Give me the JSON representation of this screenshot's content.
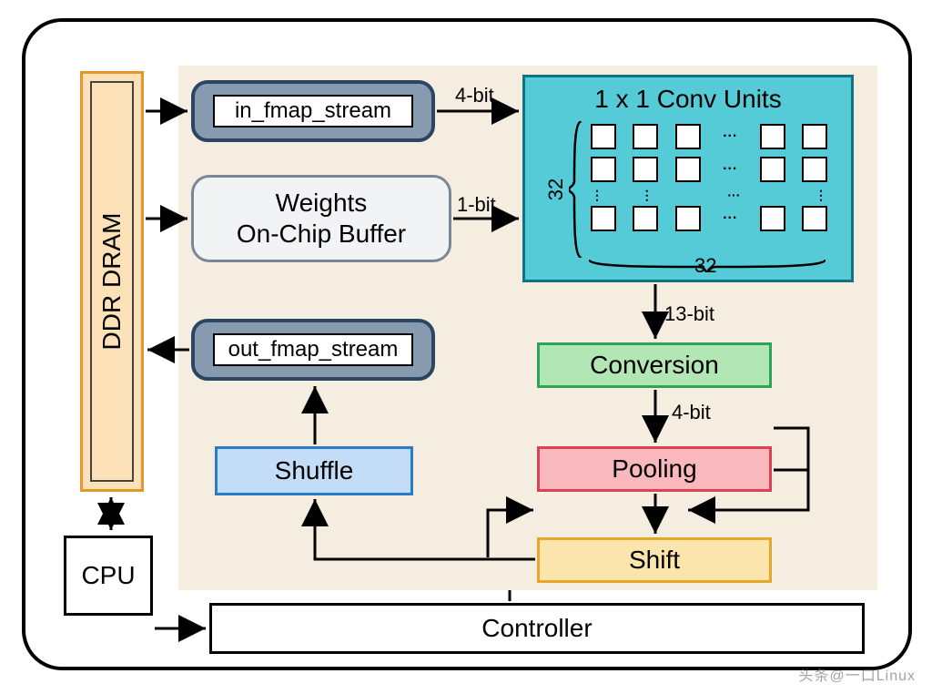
{
  "blocks": {
    "ddr": "DDR DRAM",
    "cpu": "CPU",
    "controller": "Controller",
    "in_stream": "in_fmap_stream",
    "out_stream": "out_fmap_stream",
    "weights_l1": "Weights",
    "weights_l2": "On-Chip Buffer",
    "conv_title": "1 x 1 Conv Units",
    "conv_dim": "32",
    "conversion": "Conversion",
    "pooling": "Pooling",
    "shift": "Shift",
    "shuffle": "Shuffle"
  },
  "edges": {
    "in_to_conv": "4-bit",
    "weights_to_conv": "1-bit",
    "conv_to_conversion": "13-bit",
    "conversion_to_pooling": "4-bit"
  },
  "watermark": "头条@一口Linux"
}
